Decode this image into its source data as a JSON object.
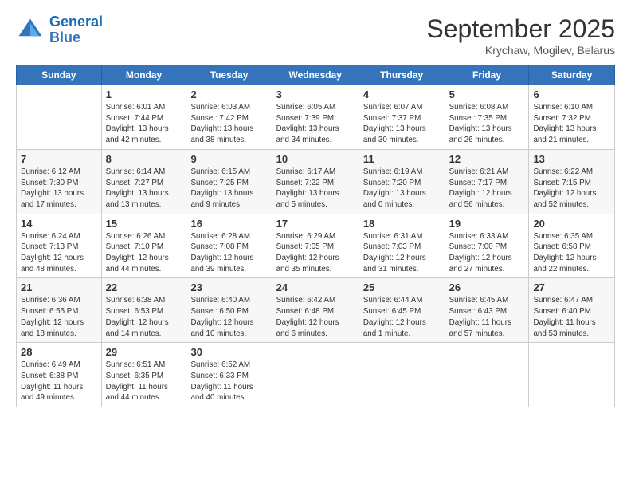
{
  "logo": {
    "line1": "General",
    "line2": "Blue"
  },
  "title": "September 2025",
  "subtitle": "Krychaw, Mogilev, Belarus",
  "days_header": [
    "Sunday",
    "Monday",
    "Tuesday",
    "Wednesday",
    "Thursday",
    "Friday",
    "Saturday"
  ],
  "weeks": [
    [
      {
        "num": "",
        "text": ""
      },
      {
        "num": "1",
        "text": "Sunrise: 6:01 AM\nSunset: 7:44 PM\nDaylight: 13 hours\nand 42 minutes."
      },
      {
        "num": "2",
        "text": "Sunrise: 6:03 AM\nSunset: 7:42 PM\nDaylight: 13 hours\nand 38 minutes."
      },
      {
        "num": "3",
        "text": "Sunrise: 6:05 AM\nSunset: 7:39 PM\nDaylight: 13 hours\nand 34 minutes."
      },
      {
        "num": "4",
        "text": "Sunrise: 6:07 AM\nSunset: 7:37 PM\nDaylight: 13 hours\nand 30 minutes."
      },
      {
        "num": "5",
        "text": "Sunrise: 6:08 AM\nSunset: 7:35 PM\nDaylight: 13 hours\nand 26 minutes."
      },
      {
        "num": "6",
        "text": "Sunrise: 6:10 AM\nSunset: 7:32 PM\nDaylight: 13 hours\nand 21 minutes."
      }
    ],
    [
      {
        "num": "7",
        "text": "Sunrise: 6:12 AM\nSunset: 7:30 PM\nDaylight: 13 hours\nand 17 minutes."
      },
      {
        "num": "8",
        "text": "Sunrise: 6:14 AM\nSunset: 7:27 PM\nDaylight: 13 hours\nand 13 minutes."
      },
      {
        "num": "9",
        "text": "Sunrise: 6:15 AM\nSunset: 7:25 PM\nDaylight: 13 hours\nand 9 minutes."
      },
      {
        "num": "10",
        "text": "Sunrise: 6:17 AM\nSunset: 7:22 PM\nDaylight: 13 hours\nand 5 minutes."
      },
      {
        "num": "11",
        "text": "Sunrise: 6:19 AM\nSunset: 7:20 PM\nDaylight: 13 hours\nand 0 minutes."
      },
      {
        "num": "12",
        "text": "Sunrise: 6:21 AM\nSunset: 7:17 PM\nDaylight: 12 hours\nand 56 minutes."
      },
      {
        "num": "13",
        "text": "Sunrise: 6:22 AM\nSunset: 7:15 PM\nDaylight: 12 hours\nand 52 minutes."
      }
    ],
    [
      {
        "num": "14",
        "text": "Sunrise: 6:24 AM\nSunset: 7:13 PM\nDaylight: 12 hours\nand 48 minutes."
      },
      {
        "num": "15",
        "text": "Sunrise: 6:26 AM\nSunset: 7:10 PM\nDaylight: 12 hours\nand 44 minutes."
      },
      {
        "num": "16",
        "text": "Sunrise: 6:28 AM\nSunset: 7:08 PM\nDaylight: 12 hours\nand 39 minutes."
      },
      {
        "num": "17",
        "text": "Sunrise: 6:29 AM\nSunset: 7:05 PM\nDaylight: 12 hours\nand 35 minutes."
      },
      {
        "num": "18",
        "text": "Sunrise: 6:31 AM\nSunset: 7:03 PM\nDaylight: 12 hours\nand 31 minutes."
      },
      {
        "num": "19",
        "text": "Sunrise: 6:33 AM\nSunset: 7:00 PM\nDaylight: 12 hours\nand 27 minutes."
      },
      {
        "num": "20",
        "text": "Sunrise: 6:35 AM\nSunset: 6:58 PM\nDaylight: 12 hours\nand 22 minutes."
      }
    ],
    [
      {
        "num": "21",
        "text": "Sunrise: 6:36 AM\nSunset: 6:55 PM\nDaylight: 12 hours\nand 18 minutes."
      },
      {
        "num": "22",
        "text": "Sunrise: 6:38 AM\nSunset: 6:53 PM\nDaylight: 12 hours\nand 14 minutes."
      },
      {
        "num": "23",
        "text": "Sunrise: 6:40 AM\nSunset: 6:50 PM\nDaylight: 12 hours\nand 10 minutes."
      },
      {
        "num": "24",
        "text": "Sunrise: 6:42 AM\nSunset: 6:48 PM\nDaylight: 12 hours\nand 6 minutes."
      },
      {
        "num": "25",
        "text": "Sunrise: 6:44 AM\nSunset: 6:45 PM\nDaylight: 12 hours\nand 1 minute."
      },
      {
        "num": "26",
        "text": "Sunrise: 6:45 AM\nSunset: 6:43 PM\nDaylight: 11 hours\nand 57 minutes."
      },
      {
        "num": "27",
        "text": "Sunrise: 6:47 AM\nSunset: 6:40 PM\nDaylight: 11 hours\nand 53 minutes."
      }
    ],
    [
      {
        "num": "28",
        "text": "Sunrise: 6:49 AM\nSunset: 6:38 PM\nDaylight: 11 hours\nand 49 minutes."
      },
      {
        "num": "29",
        "text": "Sunrise: 6:51 AM\nSunset: 6:35 PM\nDaylight: 11 hours\nand 44 minutes."
      },
      {
        "num": "30",
        "text": "Sunrise: 6:52 AM\nSunset: 6:33 PM\nDaylight: 11 hours\nand 40 minutes."
      },
      {
        "num": "",
        "text": ""
      },
      {
        "num": "",
        "text": ""
      },
      {
        "num": "",
        "text": ""
      },
      {
        "num": "",
        "text": ""
      }
    ]
  ]
}
